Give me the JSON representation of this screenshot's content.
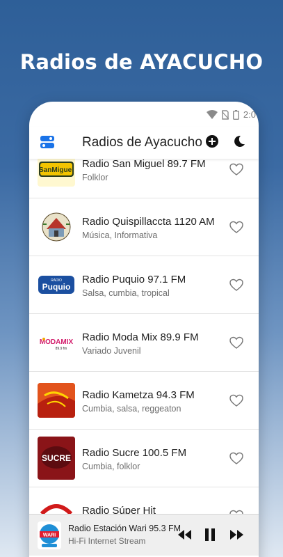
{
  "promo": {
    "title": "Radios de AYACUCHO"
  },
  "status_bar": {
    "time": "2:0"
  },
  "app_bar": {
    "title": "Radios de Ayacucho"
  },
  "stations": [
    {
      "name": "Radio San Miguel 89.7 FM",
      "genre": "Folklor"
    },
    {
      "name": "Radio Quispillaccta 1120 AM",
      "genre": "Música, Informativa"
    },
    {
      "name": "Radio Puquio 97.1 FM",
      "genre": "Salsa, cumbia, tropical"
    },
    {
      "name": "Radio Moda Mix 89.9 FM",
      "genre": "Variado Juvenil"
    },
    {
      "name": "Radio Kametza 94.3 FM",
      "genre": "Cumbia, salsa, reggeaton"
    },
    {
      "name": "Radio Sucre 100.5 FM",
      "genre": "Cumbia, folklor"
    },
    {
      "name": "Radio Súper Hit",
      "genre": ""
    }
  ],
  "logo_text": {
    "san_miguel": "SanMiguel",
    "puquio_top": "RADIO",
    "puquio": "Puquio",
    "modamix": "MODAMIX",
    "modamix_freq": "89.9 fm",
    "sucre": "SUCRE",
    "wari": "WARI"
  },
  "player": {
    "station": "Radio Estación Wari 95.3 FM",
    "subtitle": "Hi-Fi Internet Stream"
  },
  "colors": {
    "accent_blue": "#1a73e8",
    "background_top": "#2e5f98",
    "background_bottom": "#dfe8f2"
  },
  "icons": {
    "menu": "menu-toggle-icon",
    "add": "add-circle-icon",
    "dark_mode": "moon-icon",
    "favorite": "heart-outline-icon",
    "rewind": "rewind-icon",
    "pause": "pause-icon",
    "forward": "fast-forward-icon"
  }
}
